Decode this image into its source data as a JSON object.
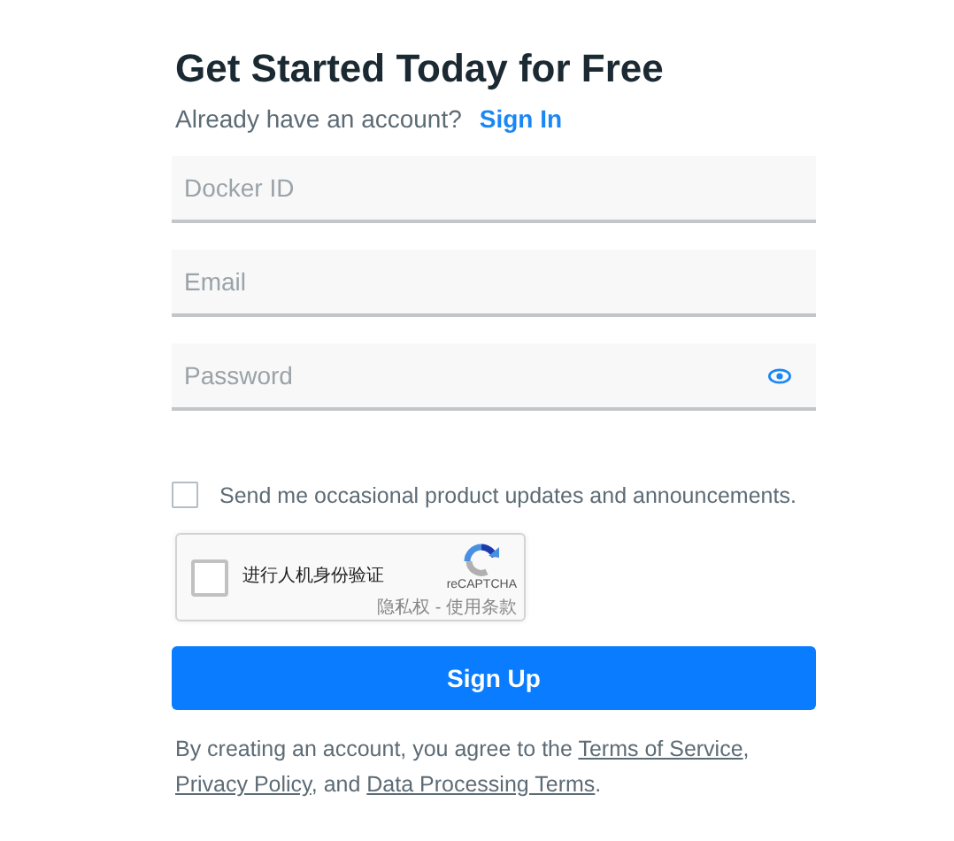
{
  "title": "Get Started Today for Free",
  "signin": {
    "prompt": "Already have an account?",
    "link": "Sign In"
  },
  "fields": [
    {
      "placeholder": "Docker ID",
      "kind": "text"
    },
    {
      "placeholder": "Email",
      "kind": "text"
    },
    {
      "placeholder": "Password",
      "kind": "password"
    }
  ],
  "updates": {
    "label": "Send me occasional product updates and announcements.",
    "checked": false
  },
  "captcha": {
    "label": "进行人机身份验证",
    "checked": false,
    "brand": "reCAPTCHA",
    "links": "隐私权 - 使用条款"
  },
  "submit": "Sign Up",
  "legal": [
    {
      "kind": "text",
      "text": "By creating an account, you agree to the "
    },
    {
      "kind": "link",
      "text": "Terms of Service"
    },
    {
      "kind": "text",
      "text": ", "
    },
    {
      "kind": "link",
      "text": "Privacy Policy"
    },
    {
      "kind": "text",
      "text": ", and "
    },
    {
      "kind": "link",
      "text": "Data Processing Terms"
    },
    {
      "kind": "text",
      "text": "."
    }
  ]
}
